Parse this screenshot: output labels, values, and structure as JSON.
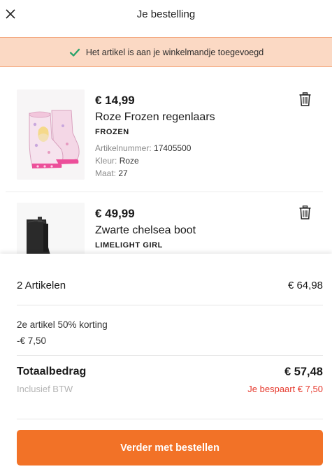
{
  "header": {
    "title": "Je bestelling",
    "close_icon": "close-icon"
  },
  "banner": {
    "text": "Het artikel is aan je winkelmandje toegevoegd",
    "icon": "checkmark-icon",
    "icon_color": "#2aa36b",
    "background": "#fbd9c4"
  },
  "cart": {
    "items": [
      {
        "price": "€ 14,99",
        "name": "Roze Frozen regenlaars",
        "brand": "FROZEN",
        "article_label": "Artikelnummer:",
        "article_number": "17405500",
        "color_label": "Kleur:",
        "color": "Roze",
        "size_label": "Maat:",
        "size": "27",
        "image_icon": "pink-rain-boot-image",
        "delete_icon": "trash-icon"
      },
      {
        "price": "€ 49,99",
        "name": "Zwarte chelsea boot",
        "brand": "LIMELIGHT GIRL",
        "image_icon": "black-chelsea-boot-image",
        "delete_icon": "trash-icon"
      }
    ]
  },
  "summary": {
    "articles_label": "2 Artikelen",
    "articles_value": "€ 64,98",
    "discount_label": "2e artikel 50% korting",
    "discount_value": "-€ 7,50",
    "total_label": "Totaalbedrag",
    "total_value": "€ 57,48",
    "vat_note": "Inclusief BTW",
    "saving_text": "Je bespaart € 7,50",
    "saving_color": "#e63a2e"
  },
  "cta": {
    "label": "Verder met bestellen",
    "color": "#f27227"
  }
}
